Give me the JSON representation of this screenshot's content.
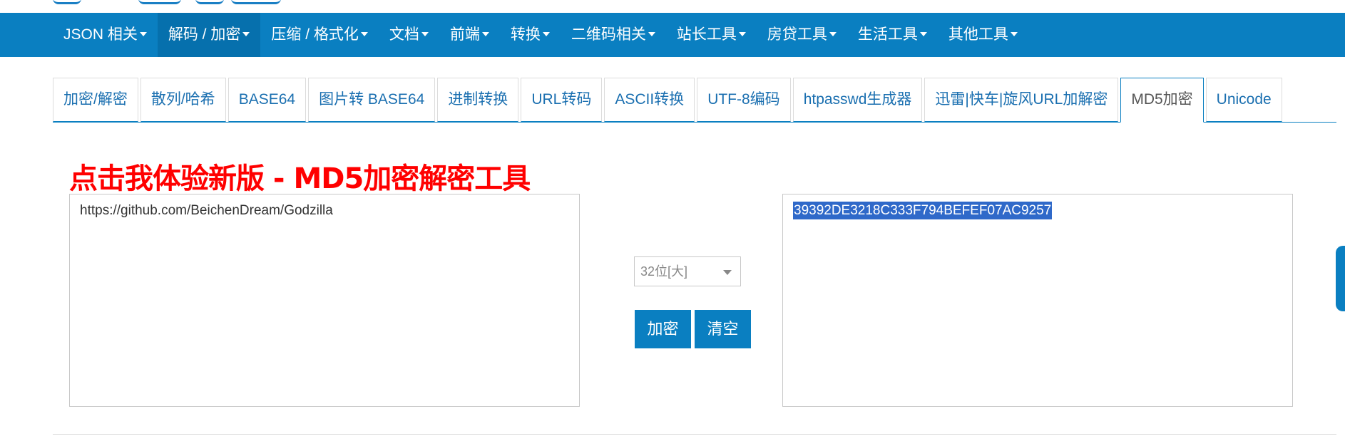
{
  "nav": {
    "items": [
      {
        "label": "JSON 相关",
        "active": false
      },
      {
        "label": "解码 / 加密",
        "active": true
      },
      {
        "label": "压缩 / 格式化",
        "active": false
      },
      {
        "label": "文档",
        "active": false
      },
      {
        "label": "前端",
        "active": false
      },
      {
        "label": "转换",
        "active": false
      },
      {
        "label": "二维码相关",
        "active": false
      },
      {
        "label": "站长工具",
        "active": false
      },
      {
        "label": "房贷工具",
        "active": false
      },
      {
        "label": "生活工具",
        "active": false
      },
      {
        "label": "其他工具",
        "active": false
      }
    ]
  },
  "tabs": [
    {
      "label": "加密/解密",
      "active": false
    },
    {
      "label": "散列/哈希",
      "active": false
    },
    {
      "label": "BASE64",
      "active": false
    },
    {
      "label": "图片转 BASE64",
      "active": false
    },
    {
      "label": "进制转换",
      "active": false
    },
    {
      "label": "URL转码",
      "active": false
    },
    {
      "label": "ASCII转换",
      "active": false
    },
    {
      "label": "UTF-8编码",
      "active": false
    },
    {
      "label": "htpasswd生成器",
      "active": false
    },
    {
      "label": "迅雷|快车|旋风URL加解密",
      "active": false
    },
    {
      "label": "MD5加密",
      "active": true
    },
    {
      "label": "Unicode",
      "active": false
    }
  ],
  "promo": {
    "text": "点击我体验新版 - MD5加密解密工具"
  },
  "input": {
    "value": "https://github.com/BeichenDream/Godzilla"
  },
  "output": {
    "value": "39392DE3218C333F794BEFEF07AC9257"
  },
  "options": {
    "selected": "32位[大]"
  },
  "buttons": {
    "encrypt": "加密",
    "clear": "清空"
  },
  "colors": {
    "primary": "#0a7fc1",
    "promo": "#ff0000",
    "selection": "#2f69c9"
  }
}
